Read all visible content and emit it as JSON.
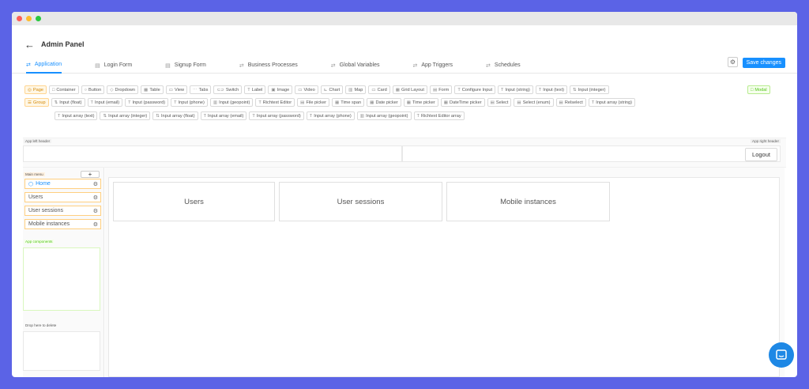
{
  "window": {
    "dots": [
      "#ff5f57",
      "#febc2e",
      "#28c840"
    ]
  },
  "header": {
    "back_icon": "arrow-left-icon",
    "title": "Admin Panel"
  },
  "tabs": [
    {
      "label": "Application",
      "icon": "⇄",
      "active": true
    },
    {
      "label": "Login Form",
      "icon": "▤",
      "active": false
    },
    {
      "label": "Signup Form",
      "icon": "▤",
      "active": false
    },
    {
      "label": "Business Processes",
      "icon": "⇄",
      "active": false
    },
    {
      "label": "Global Variables",
      "icon": "⇄",
      "active": false
    },
    {
      "label": "App Triggers",
      "icon": "⇄",
      "active": false
    },
    {
      "label": "Schedules",
      "icon": "⇄",
      "active": false
    }
  ],
  "toolbar": {
    "save_label": "Save changes",
    "accent": "#1890ff"
  },
  "components": {
    "row1": [
      {
        "label": "Page",
        "icon": "◎",
        "style": "orange"
      },
      {
        "label": "Container",
        "icon": "□"
      },
      {
        "label": "Button",
        "icon": "○"
      },
      {
        "label": "Dropdown",
        "icon": "◇"
      },
      {
        "label": "Table",
        "icon": "▦"
      },
      {
        "label": "View",
        "icon": "▭"
      },
      {
        "label": "Tabs",
        "icon": "⋯"
      },
      {
        "label": "Switch",
        "icon": "⊂⊃"
      },
      {
        "label": "Label",
        "icon": "T"
      },
      {
        "label": "Image",
        "icon": "▣"
      },
      {
        "label": "Video",
        "icon": "▭"
      },
      {
        "label": "Chart",
        "icon": "⊾"
      },
      {
        "label": "Map",
        "icon": "▥"
      },
      {
        "label": "Card",
        "icon": "▭"
      },
      {
        "label": "Grid Layout",
        "icon": "▦"
      },
      {
        "label": "Form",
        "icon": "▤"
      },
      {
        "label": "Configure Input",
        "icon": "T"
      },
      {
        "label": "Input (string)",
        "icon": "T"
      },
      {
        "label": "Input (text)",
        "icon": "T"
      },
      {
        "label": "Input (integer)",
        "icon": "⇅"
      }
    ],
    "modal": {
      "label": "Modal",
      "icon": "□"
    },
    "row2": [
      {
        "label": "Group",
        "icon": "☰",
        "style": "orange"
      },
      {
        "label": "Input (float)",
        "icon": "⇅"
      },
      {
        "label": "Input (email)",
        "icon": "T"
      },
      {
        "label": "Input (password)",
        "icon": "T"
      },
      {
        "label": "Input (phone)",
        "icon": "T"
      },
      {
        "label": "Input (geopoint)",
        "icon": "▥"
      },
      {
        "label": "Richtext Editor",
        "icon": "T"
      },
      {
        "label": "File picker",
        "icon": "▤"
      },
      {
        "label": "Time span",
        "icon": "▦"
      },
      {
        "label": "Date picker",
        "icon": "▦"
      },
      {
        "label": "Time picker",
        "icon": "▦"
      },
      {
        "label": "DateTime picker",
        "icon": "▦"
      },
      {
        "label": "Select",
        "icon": "▤"
      },
      {
        "label": "Select (enum)",
        "icon": "▤"
      },
      {
        "label": "Relselect",
        "icon": "▤"
      },
      {
        "label": "Input array (string)",
        "icon": "T"
      }
    ],
    "row3": [
      {
        "label": "Input array (text)",
        "icon": "T"
      },
      {
        "label": "Input array (integer)",
        "icon": "⇅"
      },
      {
        "label": "Input array (float)",
        "icon": "⇅"
      },
      {
        "label": "Input array (email)",
        "icon": "T"
      },
      {
        "label": "Input array (password)",
        "icon": "T"
      },
      {
        "label": "Input array (phone)",
        "icon": "T"
      },
      {
        "label": "Input array (geopoint)",
        "icon": "▥"
      },
      {
        "label": "Richtext Editor array",
        "icon": "T"
      }
    ]
  },
  "app_header": {
    "left_label": "App left header",
    "right_label": "App right header",
    "logout_label": "Logout"
  },
  "sidebar": {
    "main_menu_label": "Main menu",
    "add_label": "+",
    "items": [
      {
        "label": "Home",
        "icon": "⬡",
        "active": true
      },
      {
        "label": "Users",
        "icon": "",
        "active": false
      },
      {
        "label": "User sessions",
        "icon": "",
        "active": false
      },
      {
        "label": "Mobile instances",
        "icon": "",
        "active": false
      }
    ],
    "app_components_label": "App components",
    "drop_delete_label": "Drop here to delete"
  },
  "canvas": {
    "cards": [
      "Users",
      "User sessions",
      "Mobile instances"
    ]
  },
  "chat": {
    "icon": "chat-bubble-icon",
    "color": "#1e88e5"
  }
}
